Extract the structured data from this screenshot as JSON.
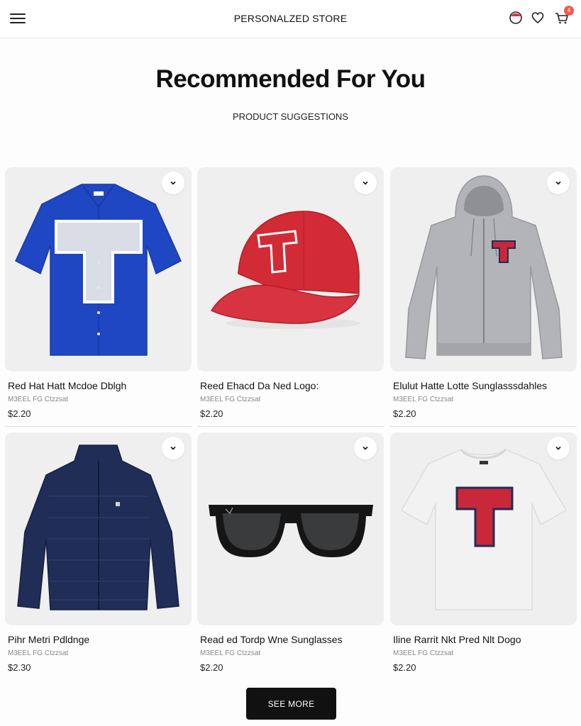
{
  "header": {
    "store_name": "PERSONALZED STORE",
    "icons": [
      "menu-icon",
      "profile-icon",
      "heart-icon",
      "cart-icon"
    ],
    "cart_badge": "4"
  },
  "hero": {
    "title": "Recommended For You",
    "subtitle": "PRODUCT SUGGESTIONS"
  },
  "products": [
    {
      "name": "Red Hat Hatt Mcdoe Dblgh",
      "meta": "M3EEL FG Ctzzsat",
      "price": "$2.20",
      "image": "blue-button-shirt-T"
    },
    {
      "name": "Reed Ehacd Da Ned Logo:",
      "meta": "M3EEL FG Ctzzsat",
      "price": "$2.20",
      "image": "red-cap-T"
    },
    {
      "name": "Elulut Hatte Lotte Sunglasssdahles",
      "meta": "M3EEL FG Ctzzsat",
      "price": "$2.20",
      "image": "grey-zip-hoodie-T"
    },
    {
      "name": "Pihr Metri Pdldnge",
      "meta": "M3EEL FG Ctzzsat",
      "price": "$2.30",
      "image": "navy-puffer-jacket"
    },
    {
      "name": "Read ed Tordp Wne Sunglasses",
      "meta": "M3EEL FG Ctzzsat",
      "price": "$2.20",
      "image": "black-sunglasses"
    },
    {
      "name": "Iline Rarrit Nkt Pred Nlt Dogo",
      "meta": "M3EEL FG Ctzzsat",
      "price": "$2.20",
      "image": "white-tshirt-T"
    }
  ],
  "actions": {
    "see_more": "SEE MORE"
  },
  "colors": {
    "accent_red": "#cc2b3a",
    "royal_blue": "#1f47c4",
    "navy": "#1f2d57",
    "badge": "#f05a4f",
    "button": "#111111"
  }
}
